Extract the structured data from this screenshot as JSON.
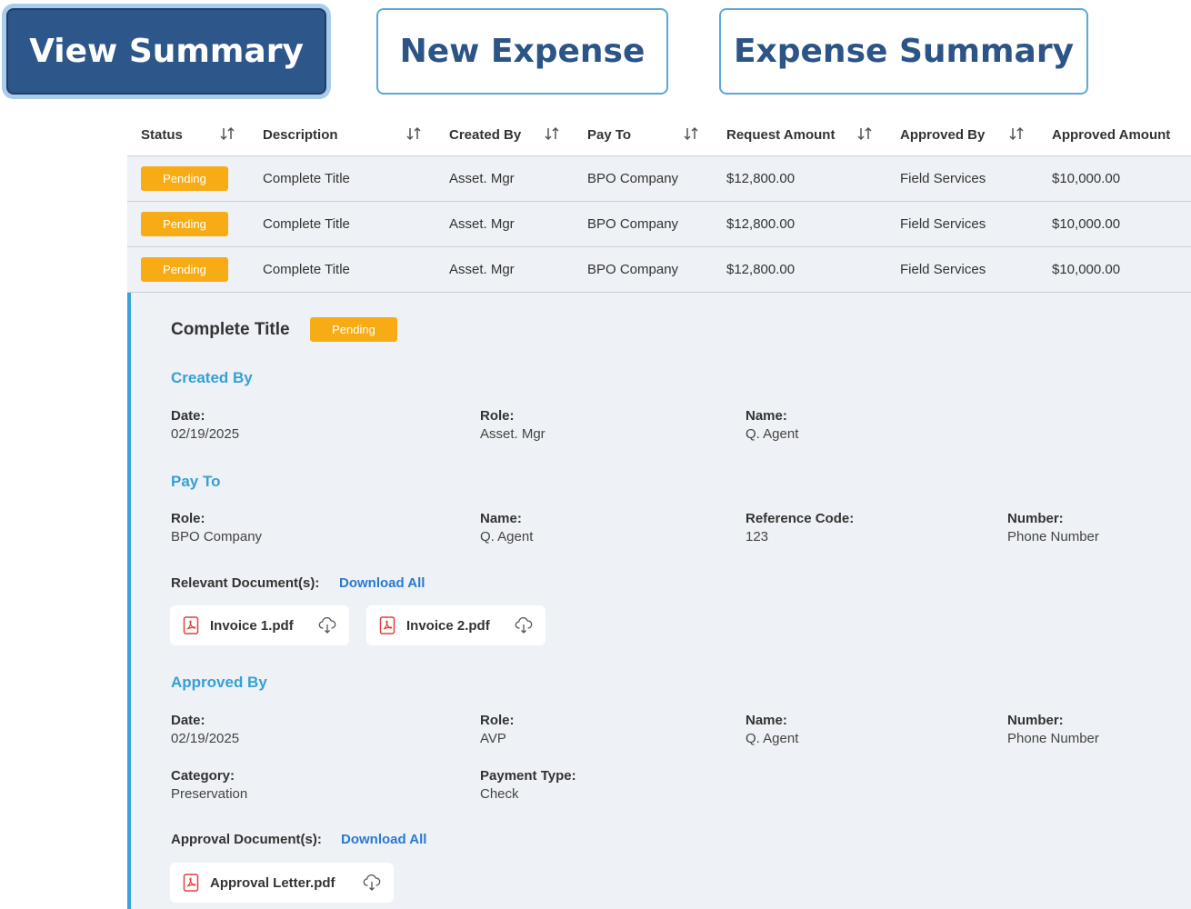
{
  "tabs": {
    "view_summary": "View Summary",
    "new_expense": "New Expense",
    "expense_summary": "Expense Summary"
  },
  "table": {
    "headers": [
      "Status",
      "Description",
      "Created By",
      "Pay To",
      "Request Amount",
      "Approved By",
      "Approved Amount"
    ],
    "rows": [
      {
        "status": "Pending",
        "description": "Complete Title",
        "created_by": "Asset. Mgr",
        "pay_to": "BPO Company",
        "request_amount": "$12,800.00",
        "approved_by": "Field Services",
        "approved_amount": "$10,000.00"
      },
      {
        "status": "Pending",
        "description": "Complete Title",
        "created_by": "Asset. Mgr",
        "pay_to": "BPO Company",
        "request_amount": "$12,800.00",
        "approved_by": "Field Services",
        "approved_amount": "$10,000.00"
      },
      {
        "status": "Pending",
        "description": "Complete Title",
        "created_by": "Asset. Mgr",
        "pay_to": "BPO Company",
        "request_amount": "$12,800.00",
        "approved_by": "Field Services",
        "approved_amount": "$10,000.00"
      }
    ]
  },
  "detail": {
    "title": "Complete Title",
    "status": "Pending",
    "created_by": {
      "heading": "Created By",
      "date_label": "Date:",
      "date": "02/19/2025",
      "role_label": "Role:",
      "role": "Asset. Mgr",
      "name_label": "Name:",
      "name": "Q. Agent"
    },
    "pay_to": {
      "heading": "Pay To",
      "role_label": "Role:",
      "role": "BPO Company",
      "name_label": "Name:",
      "name": "Q. Agent",
      "ref_label": "Reference Code:",
      "ref": "123",
      "number_label": "Number:",
      "number": "Phone Number"
    },
    "relevant_docs": {
      "label": "Relevant Document(s):",
      "download_all": "Download All",
      "files": [
        "Invoice 1.pdf",
        "Invoice 2.pdf"
      ]
    },
    "approved_by": {
      "heading": "Approved By",
      "date_label": "Date:",
      "date": "02/19/2025",
      "role_label": "Role:",
      "role": "AVP",
      "name_label": "Name:",
      "name": "Q. Agent",
      "number_label": "Number:",
      "number": "Phone Number",
      "category_label": "Category:",
      "category": "Preservation",
      "payment_label": "Payment Type:",
      "payment": "Check"
    },
    "approval_docs": {
      "label": "Approval Document(s):",
      "download_all": "Download All",
      "files": [
        "Approval Letter.pdf"
      ]
    }
  },
  "colors": {
    "primary": "#2d568a",
    "accent": "#35a1d6",
    "pending": "#f7ac16",
    "link": "#2a7ad1",
    "pdf": "#e0413b"
  }
}
